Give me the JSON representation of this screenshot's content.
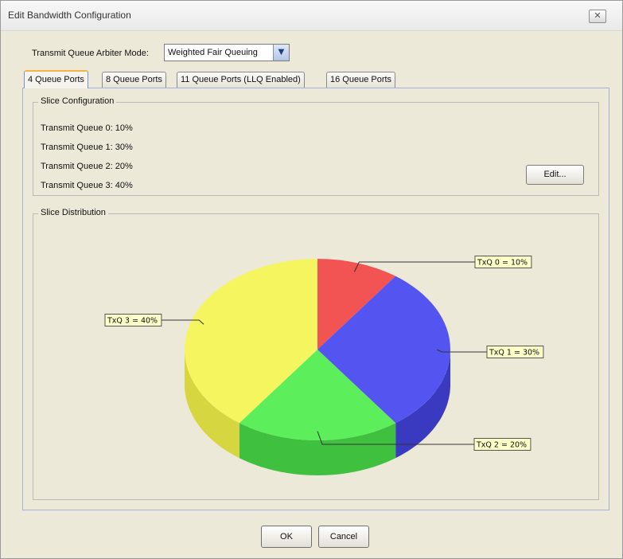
{
  "window": {
    "title": "Edit Bandwidth Configuration",
    "close_label": "✕"
  },
  "arbiter": {
    "label": "Transmit Queue Arbiter Mode:",
    "selected": "Weighted Fair Queuing"
  },
  "tabs": [
    {
      "label": "4 Queue Ports",
      "active": true
    },
    {
      "label": "8 Queue Ports",
      "active": false
    },
    {
      "label": "11 Queue Ports (LLQ Enabled)",
      "active": false
    },
    {
      "label": "16 Queue Ports",
      "active": false
    }
  ],
  "slice_config": {
    "legend": "Slice Configuration",
    "queues": [
      {
        "label": "Transmit Queue 0:",
        "value": "10%"
      },
      {
        "label": "Transmit Queue 1:",
        "value": "30%"
      },
      {
        "label": "Transmit Queue 2:",
        "value": "20%"
      },
      {
        "label": "Transmit Queue 3:",
        "value": "40%"
      }
    ],
    "edit_label": "Edit..."
  },
  "slice_distribution": {
    "legend": "Slice Distribution"
  },
  "chart_data": {
    "type": "pie",
    "title": "",
    "categories": [
      "TxQ 0",
      "TxQ 1",
      "TxQ 2",
      "TxQ 3"
    ],
    "values": [
      10,
      30,
      20,
      40
    ],
    "labels": [
      "TxQ 0 = 10%",
      "TxQ 1 = 30%",
      "TxQ 2 = 20%",
      "TxQ 3 = 40%"
    ],
    "colors": [
      "#f24c4c",
      "#4c4cf2",
      "#55ee55",
      "#f5f55a"
    ],
    "side_colors": [
      "#b53a3a",
      "#3a3ac0",
      "#3fc03f",
      "#d6d640"
    ],
    "legend": "none"
  },
  "buttons": {
    "ok": "OK",
    "cancel": "Cancel"
  }
}
